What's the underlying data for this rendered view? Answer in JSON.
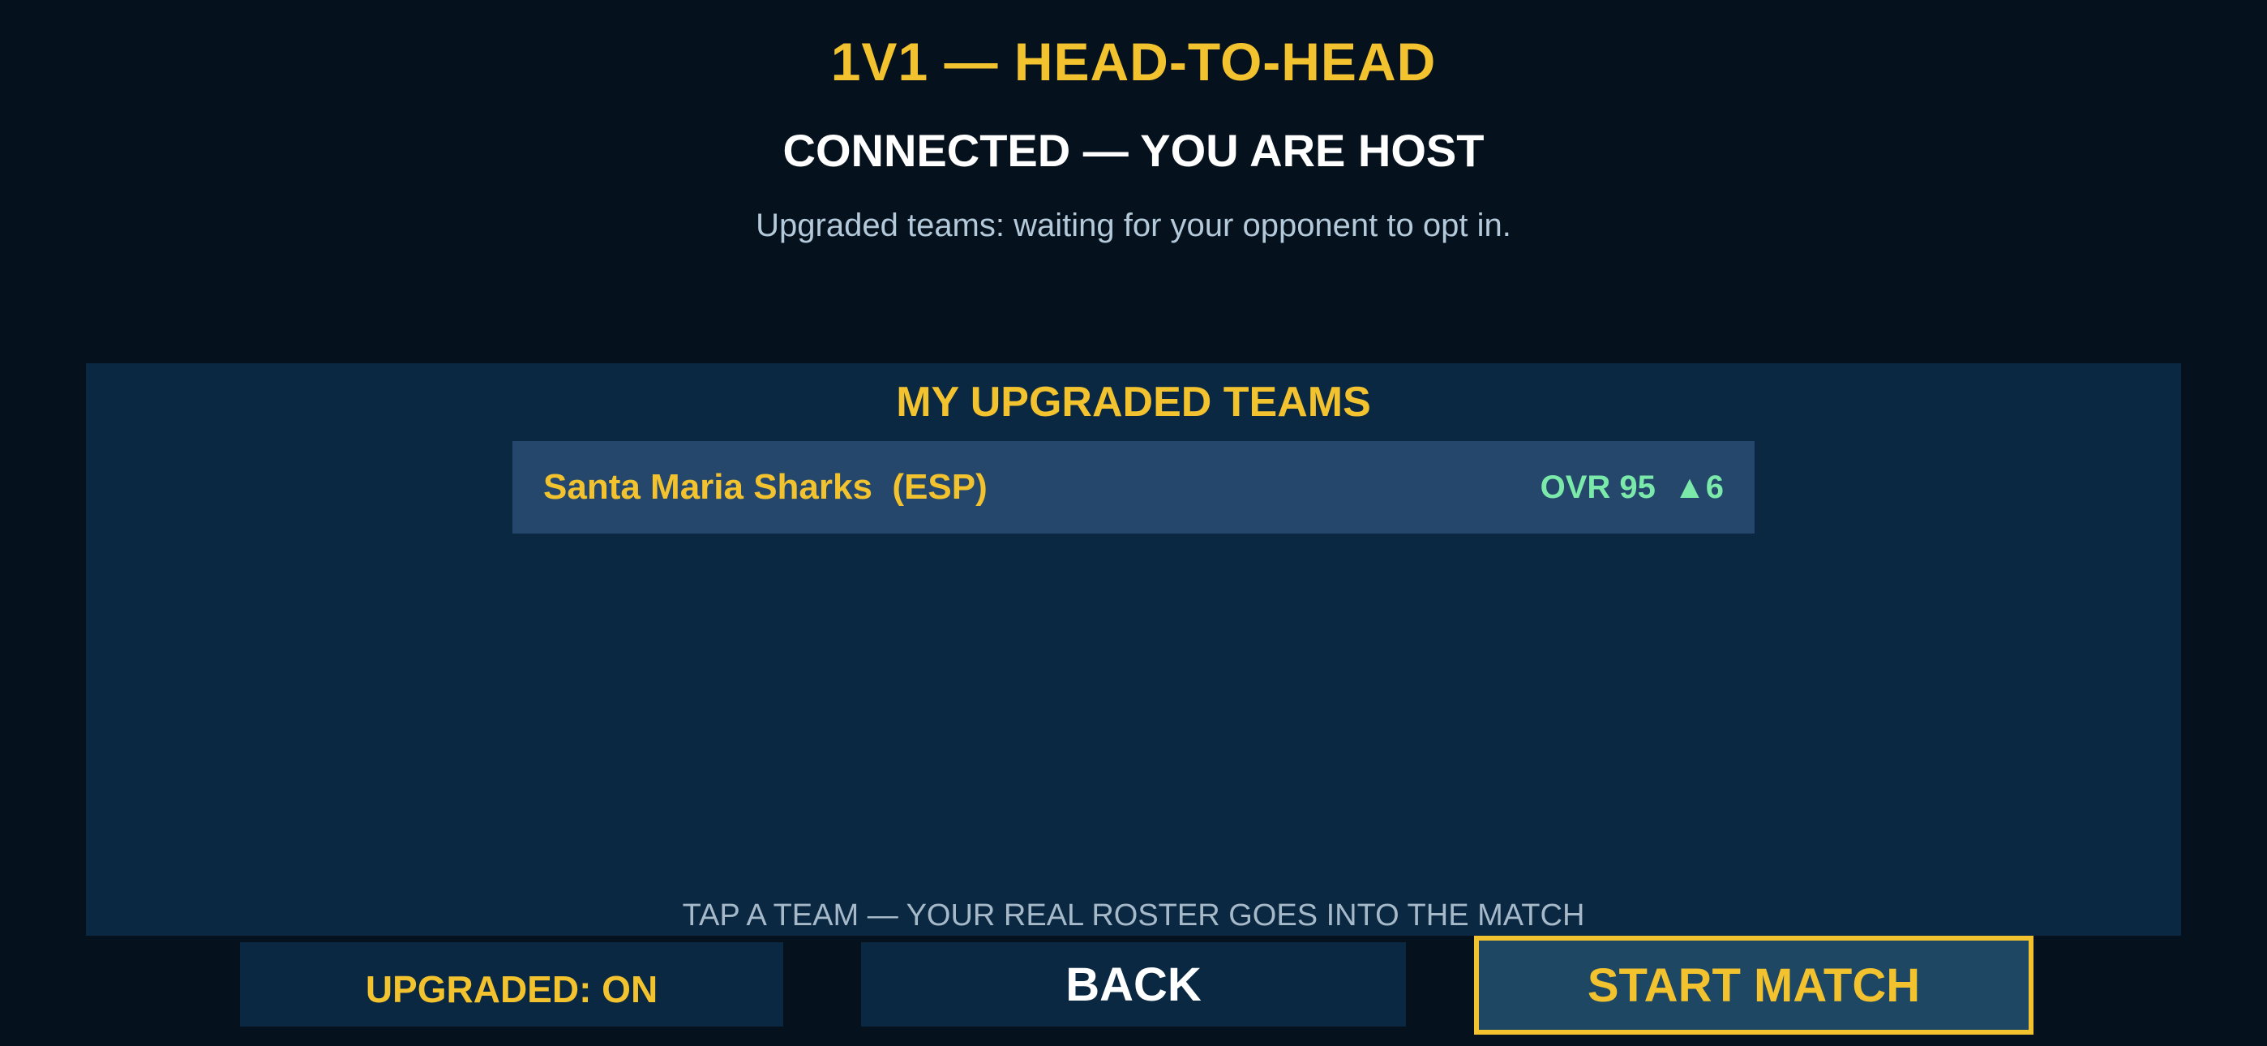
{
  "header": {
    "title": "1V1 — HEAD-TO-HEAD",
    "status": "CONNECTED — YOU ARE HOST",
    "substatus": "Upgraded teams: waiting for your opponent to opt in."
  },
  "panel": {
    "title": "MY UPGRADED TEAMS",
    "teams": [
      {
        "name": "Santa Maria Sharks  (ESP)",
        "stats": "OVR 95  ▲6"
      }
    ],
    "hint": "TAP A TEAM — YOUR REAL ROSTER GOES INTO THE MATCH"
  },
  "buttons": {
    "upgraded": "UPGRADED: ON",
    "back": "BACK",
    "start": "START MATCH"
  },
  "colors": {
    "background": "#05121e",
    "panel": "#0b2843",
    "accent": "#f2c22f",
    "rating": "#7ae9a9"
  }
}
